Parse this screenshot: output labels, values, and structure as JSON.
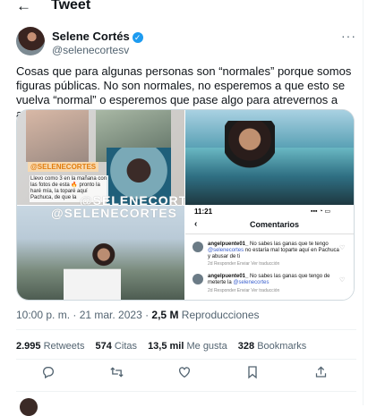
{
  "header": {
    "back_icon": "arrow-left-icon",
    "title": "Tweet"
  },
  "author": {
    "name": "Selene Cortés",
    "handle": "@selenecortesv",
    "verified_icon": "verified-check-icon"
  },
  "tweet": {
    "text": "Cosas que para algunas personas son “normales” porque somos figuras públicas. No son normales, no esperemos a que esto se vuelva “normal” o esperemos que pase algo para atrevernos a actuar."
  },
  "media": {
    "tag": "@SELENECORTES",
    "caption": "Llevo como 3 en la mañana con las fotos de esta 🔥 pronto la haré mía, la toparé aquí Pachuca, de que la",
    "watermark": "@SELENECORTES",
    "screen": {
      "time": "11:21",
      "status_icons": "▪▪▪ ◔ ▭",
      "title": "Comentarios",
      "comments": [
        {
          "user": "angelpuente01_",
          "text": "No sabes las ganas que te tengo",
          "mention": "@selenecortes",
          "text2": "no estaría mal toparte aquí en Pachuca y abusar de ti",
          "meta": "2d   Responder   Enviar   Ver traducción"
        },
        {
          "user": "angelpuente01_",
          "text": "No sabes las ganas que tengo de meterte la",
          "mention": "@selenecortes",
          "text2": "",
          "meta": "2d   Responder   Enviar   Ver traducción"
        }
      ]
    }
  },
  "meta": {
    "time": "10:00 p. m. · 21 mar. 2023 · ",
    "views": "2,5 M",
    "views_label": " Reproducciones"
  },
  "stats": {
    "retweets": "2.995",
    "retweets_label": " Retweets",
    "quotes": "574",
    "quotes_label": " Citas",
    "likes": "13,5 mil",
    "likes_label": " Me gusta",
    "bookmarks": "328",
    "bookmarks_label": " Bookmarks"
  },
  "actions": [
    "reply-icon",
    "retweet-icon",
    "like-icon",
    "bookmark-icon",
    "share-icon"
  ],
  "colors": {
    "accent": "#1d9bf0",
    "muted": "#536471",
    "text": "#0f1419"
  }
}
